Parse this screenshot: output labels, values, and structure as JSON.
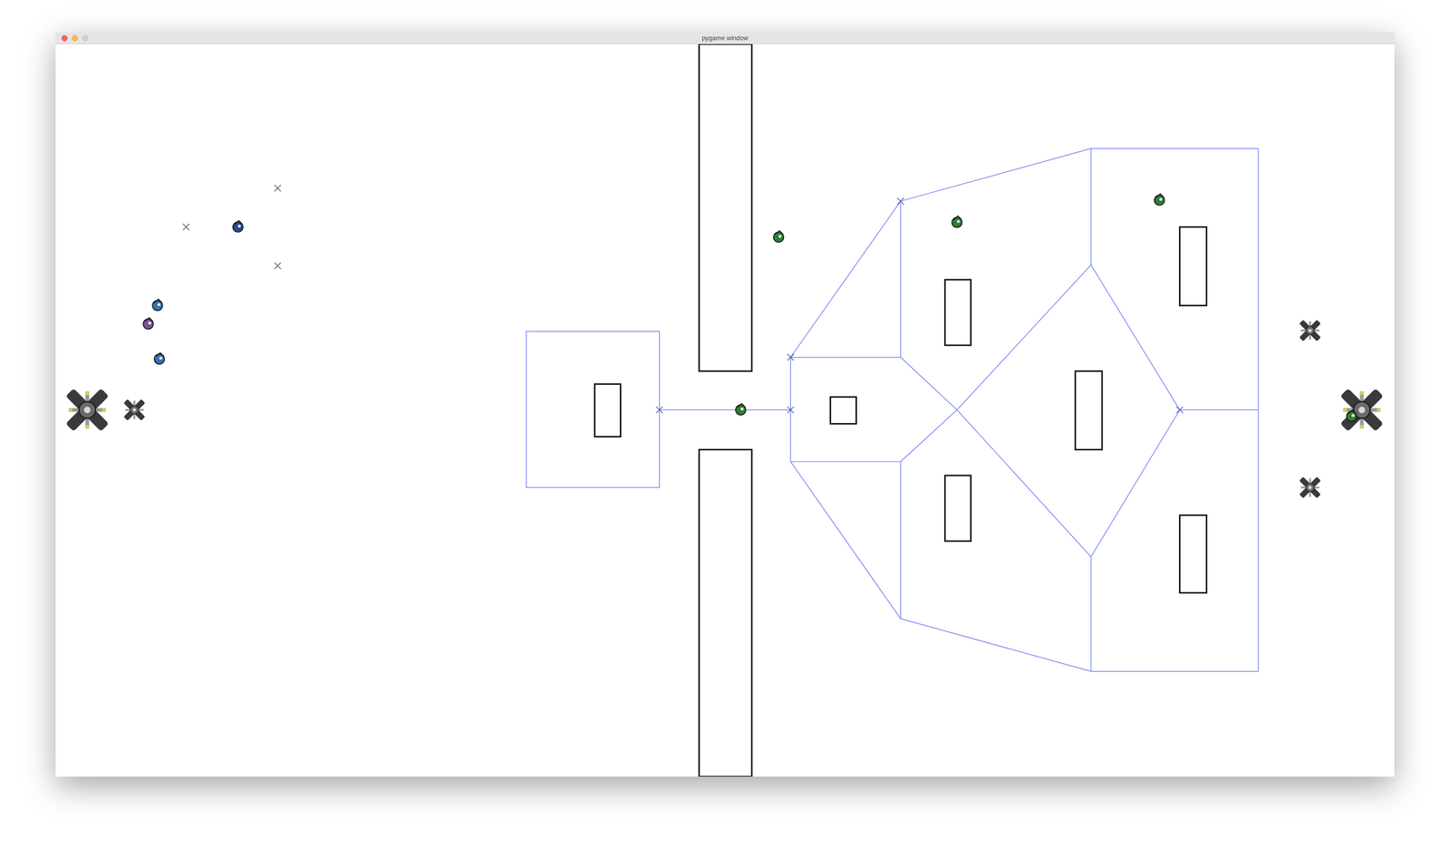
{
  "window": {
    "title": "pygame window"
  },
  "units": [
    {
      "color": "#2b4a8f"
    },
    {
      "color": "#3a6fb0"
    },
    {
      "color": "#7a4f9a"
    },
    {
      "color": "#3a6fb0"
    },
    {
      "color": "#2e7d32"
    },
    {
      "color": "#2e7d32"
    },
    {
      "color": "#2e7d32"
    },
    {
      "color": "#2e7d32"
    },
    {
      "color": "#2e7d32"
    }
  ],
  "bases": [
    {
      "kind": "main"
    },
    {
      "kind": "tower"
    },
    {
      "kind": "main"
    },
    {
      "kind": "tower"
    },
    {
      "kind": "tower"
    }
  ]
}
